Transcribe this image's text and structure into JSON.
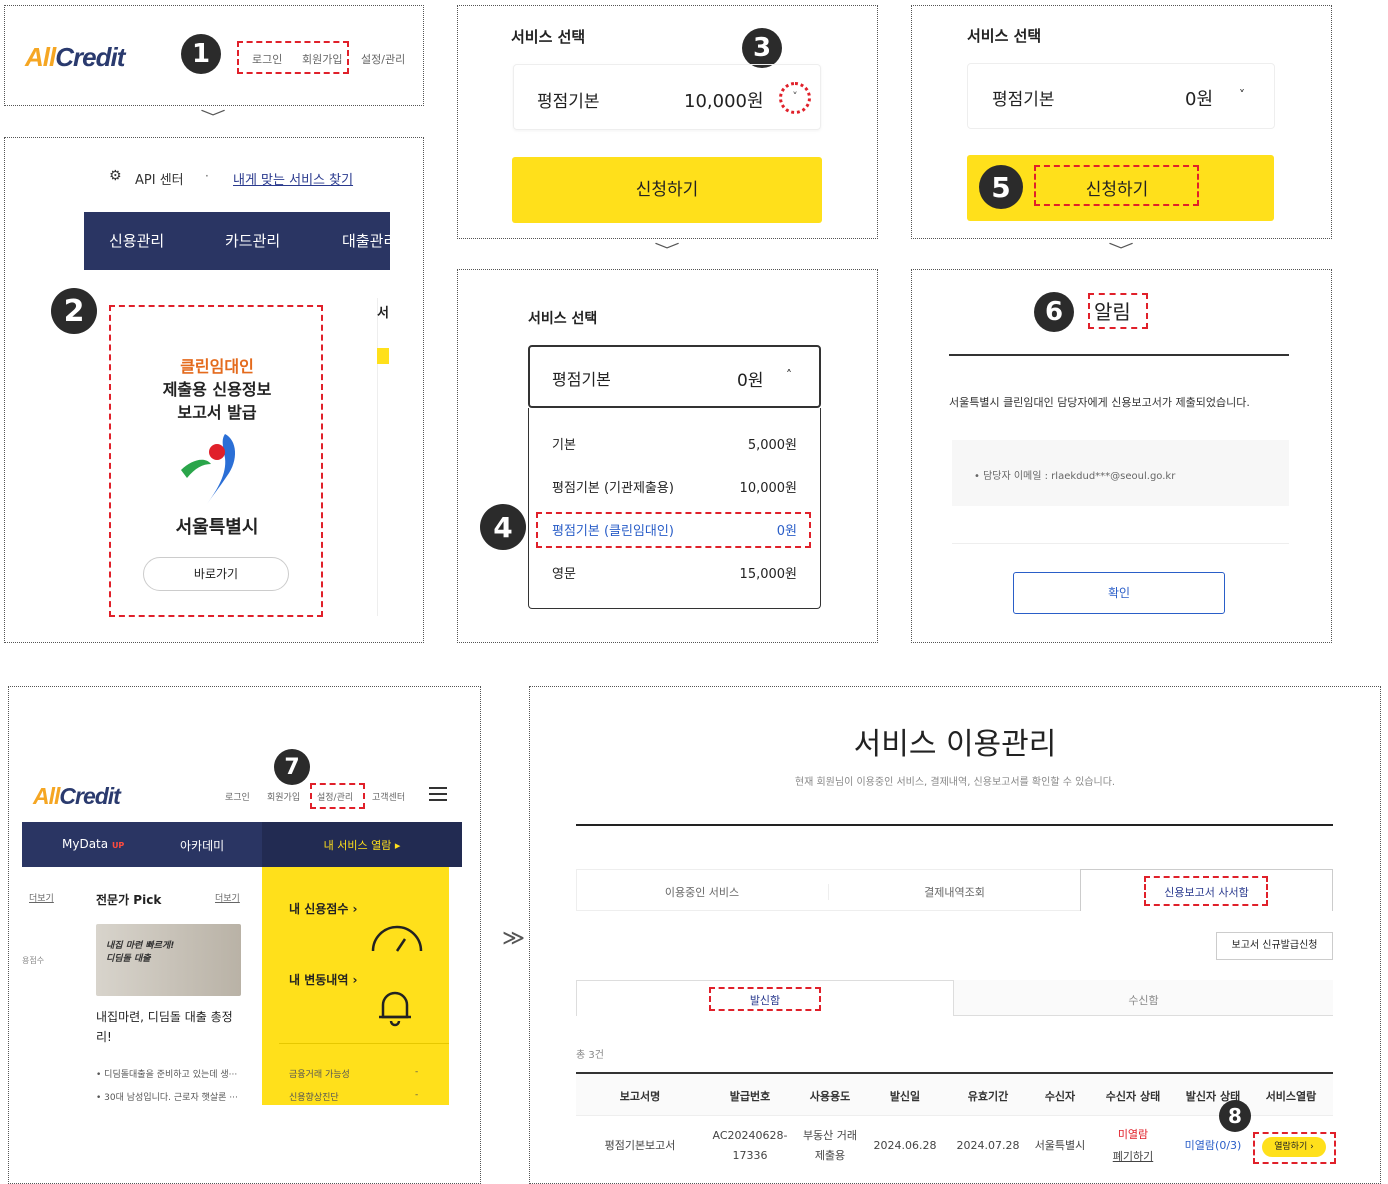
{
  "p1": {
    "logo_a": "All",
    "logo_b": "Credit",
    "login": "로그인",
    "signup": "회원가입",
    "settings": "설정/관리",
    "step": "1"
  },
  "p2": {
    "api": "API 센터",
    "find": "내게 맞는 서비스 찾기",
    "nav": [
      "신용관리",
      "카드관리",
      "대출관리"
    ],
    "step": "2",
    "card_title1": "클린임대인",
    "card_title2": "제출용 신용정보",
    "card_title3": "보고서 발급",
    "city": "서울특별시",
    "go": "바로가기",
    "side": "서"
  },
  "p3": {
    "title": "서비스 선택",
    "product": "평점기본",
    "price": "10,000원",
    "apply": "신청하기",
    "step": "3"
  },
  "p4": {
    "title": "서비스 선택",
    "product": "평점기본",
    "price": "0원",
    "options": [
      {
        "name": "기본",
        "price": "5,000원"
      },
      {
        "name": "평점기본 (기관제출용)",
        "price": "10,000원"
      },
      {
        "name": "평점기본 (클린임대인)",
        "price": "0원"
      },
      {
        "name": "영문",
        "price": "15,000원"
      }
    ],
    "step": "4"
  },
  "p5": {
    "title": "서비스 선택",
    "product": "평점기본",
    "price": "0원",
    "apply": "신청하기",
    "step": "5"
  },
  "p6": {
    "title": "알림",
    "step": "6",
    "message": "서울특별시 클린임대인 담당자에게 신용보고서가 제출되었습니다.",
    "email": "• 담당자 이메일 : rlaekdud***@seoul.go.kr",
    "confirm": "확인"
  },
  "p7": {
    "logo_a": "All",
    "logo_b": "Credit",
    "links": [
      "로그인",
      "회원가입",
      "설정/관리",
      "고객센터"
    ],
    "step": "7",
    "nav_mydata": "MyData",
    "nav_up": "UP",
    "nav_academy": "아카데미",
    "nav_service": "내 서비스 열람 ▸",
    "more_left": "더보기",
    "pick": "전문가 Pick",
    "more": "더보기",
    "img_text1": "내집 마련 빠르게!",
    "img_text2": "디딤돌 대출",
    "article": "내집마련, 디딤돌 대출 총정리!",
    "bullets": [
      "• 디딤돌대출을 준비하고 있는데 생···",
      "• 30대 남성입니다. 근로자 햇살론 ···"
    ],
    "score": "내 신용점수 ›",
    "change": "내 변동내역 ›",
    "fin": "금융거래 가능성",
    "fin_v": "-",
    "improve": "신용향상진단",
    "improve_v": "-",
    "left_text": "용점수"
  },
  "p8": {
    "title": "서비스 이용관리",
    "subtitle": "현재 회원님이 이용중인 서비스, 결제내역, 신용보고서를 확인할 수 있습니다.",
    "tabs": [
      "이용중인 서비스",
      "결제내역조회",
      "신용보고서 사서함"
    ],
    "new_btn": "보고서 신규발급신청",
    "subtabs": [
      "발신함",
      "수신함"
    ],
    "total": "총 3건",
    "headers": [
      "보고서명",
      "발급번호",
      "사용용도",
      "발신일",
      "유효기간",
      "수신자",
      "수신자 상태",
      "발신자 상태",
      "서비스열람"
    ],
    "row": {
      "name": "평점기본보고서",
      "no1": "AC20240628-",
      "no2": "17336",
      "use1": "부동산 거래",
      "use2": "제출용",
      "sent": "2024.06.28",
      "valid": "2024.07.28",
      "receiver": "서울특별시",
      "rstatus": "미열람",
      "rdelete": "폐기하기",
      "sstatus": "미열람(0/3)",
      "view": "열람하기 ›"
    },
    "step": "8"
  },
  "arrows": {
    "down": "﹀",
    "right": "≫"
  }
}
